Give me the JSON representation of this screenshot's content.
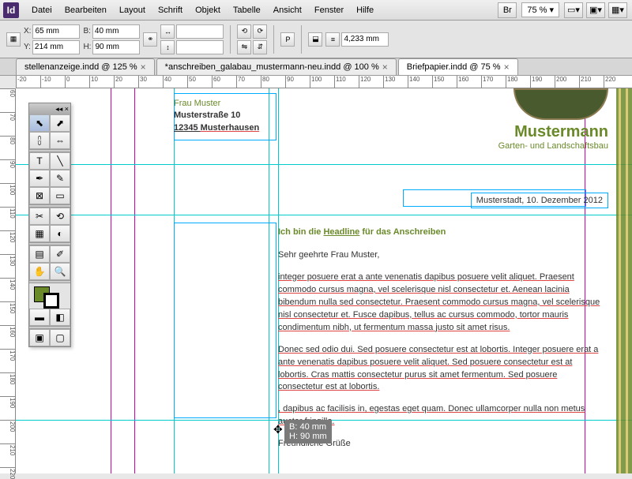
{
  "app": {
    "icon_label": "Id"
  },
  "menu": [
    "Datei",
    "Bearbeiten",
    "Layout",
    "Schrift",
    "Objekt",
    "Tabelle",
    "Ansicht",
    "Fenster",
    "Hilfe"
  ],
  "menubar_extras": {
    "zoom": "75 %"
  },
  "control": {
    "x_label": "X:",
    "x": "65 mm",
    "y_label": "Y:",
    "y": "214 mm",
    "w_label": "B:",
    "w": "40 mm",
    "h_label": "H:",
    "h": "90 mm",
    "stroke_label": "",
    "stroke": "4,233 mm"
  },
  "tabs": [
    {
      "label": "stellenanzeige.indd @ 125 %",
      "active": false
    },
    {
      "label": "*anschreiben_galabau_mustermann-neu.indd @ 100 %",
      "active": false
    },
    {
      "label": "Briefpapier.indd @ 75 %",
      "active": true
    }
  ],
  "ruler_h": [
    -20,
    -10,
    0,
    10,
    20,
    30,
    40,
    50,
    60,
    70,
    80,
    90,
    100,
    110,
    120,
    130,
    140,
    150,
    160,
    170,
    180,
    190,
    200,
    210,
    220
  ],
  "ruler_v": [
    60,
    70,
    80,
    90,
    100,
    110,
    120,
    130,
    140,
    150,
    160,
    170,
    180,
    190,
    200,
    210,
    220
  ],
  "address": {
    "line1": "Frau Muster",
    "line2": "Musterstraße 10",
    "line3_a": "12345 ",
    "line3_b": "Musterhausen"
  },
  "brand": {
    "name": "Mustermann",
    "sub": "Garten- und Landschaftsbau"
  },
  "dateline": "Musterstadt, 10. Dezember 2012",
  "headline_pre": "Ich bin die ",
  "headline_u": "Headline",
  "headline_post": " für das Anschreiben",
  "body": {
    "greeting": "Sehr geehrte Frau Muster,",
    "p1": "integer posuere erat a ante venenatis dapibus posuere velit aliquet. Praesent commodo cursus magna, vel scelerisque nisl consectetur et. Aenean lacinia bibendum nulla sed consectetur. Praesent commodo cursus magna, vel scelerisque nisl consectetur et. Fusce dapibus, tellus ac cursus commodo, tortor mauris condimentum nibh, ut fermentum massa justo sit amet risus.",
    "p2": "Donec sed odio dui. Sed posuere consectetur est at lobortis. Integer posuere erat a ante venenatis dapibus posuere velit aliquet. Sed posuere consectetur est at lobortis. Cras mattis consectetur purus sit amet fermentum. Sed posuere consectetur est at lobortis.",
    "p3a": "",
    "p3b": ", dapibus ac facilisis in, egestas eget quam. Donec ullamcorper nulla non metus auctor fringilla.",
    "closing": "Freundliche Grüße"
  },
  "tooltip": {
    "b": "B: 40 mm",
    "h": "H: 90 mm"
  },
  "tools": [
    "▲",
    "↔",
    "�页",
    "⊞",
    "T",
    "/",
    "✎",
    "✂",
    "▭",
    "○",
    "⬡",
    "□",
    "⇄",
    "◐",
    "✥",
    "🔍"
  ]
}
